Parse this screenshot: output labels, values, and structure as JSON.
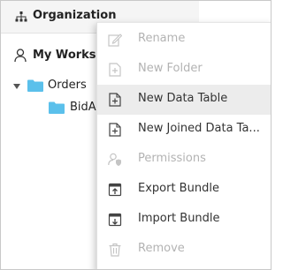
{
  "tree": {
    "organization_label": "Organization",
    "workspace_label": "My Workspace",
    "items": [
      {
        "label": "Orders",
        "expanded": true
      },
      {
        "label": "BidAs"
      }
    ]
  },
  "context_menu": {
    "items": [
      {
        "label": "Rename",
        "icon": "edit-icon",
        "enabled": false
      },
      {
        "label": "New Folder",
        "icon": "new-folder-icon",
        "enabled": false
      },
      {
        "label": "New Data Table",
        "icon": "new-data-table-icon",
        "enabled": true,
        "hovered": true
      },
      {
        "label": "New Joined Data Ta...",
        "icon": "new-joined-data-table-icon",
        "enabled": true
      },
      {
        "label": "Permissions",
        "icon": "permissions-icon",
        "enabled": false
      },
      {
        "label": "Export Bundle",
        "icon": "export-bundle-icon",
        "enabled": true
      },
      {
        "label": "Import Bundle",
        "icon": "import-bundle-icon",
        "enabled": true
      },
      {
        "label": "Remove",
        "icon": "trash-icon",
        "enabled": false
      }
    ]
  },
  "colors": {
    "folder": "#5bc0eb",
    "disabled_text": "#b3b3b3",
    "enabled_text": "#333333",
    "hover_bg": "#ececec"
  }
}
